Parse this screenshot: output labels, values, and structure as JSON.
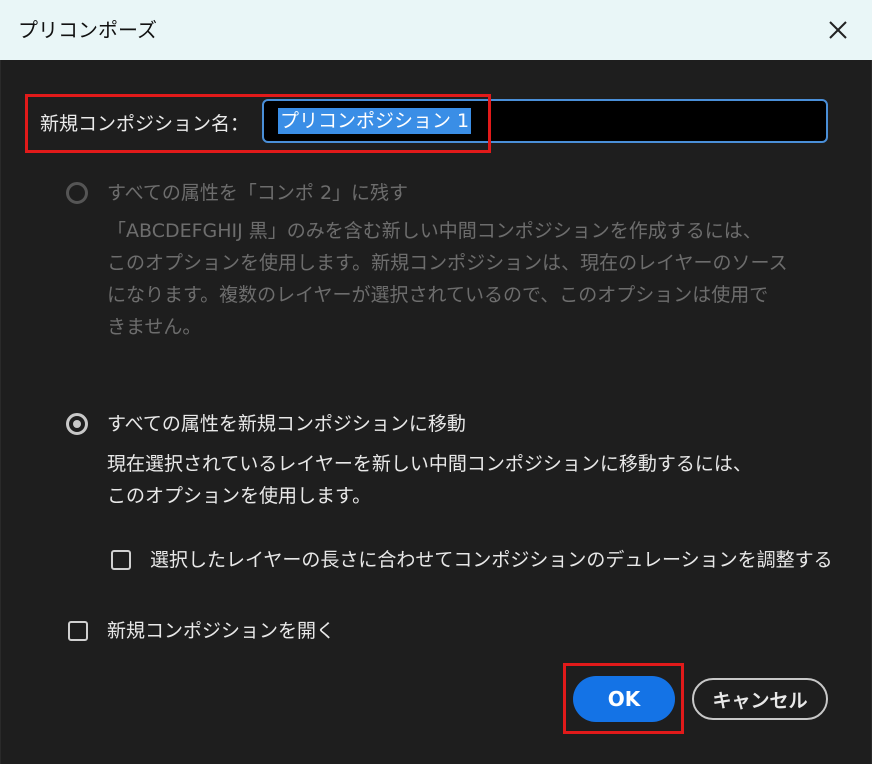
{
  "window": {
    "title": "プリコンポーズ",
    "close_icon": "close-icon"
  },
  "name_field": {
    "label": "新規コンポジション名：",
    "value": "プリコンポジション 1"
  },
  "option_leave": {
    "title": "すべての属性を「コンポ 2」に残す",
    "description": "「ABCDEFGHIJ 黒」のみを含む新しい中間コンポジションを作成するには、\nこのオプションを使用します。新規コンポジションは、現在のレイヤーのソース\nになります。複数のレイヤーが選択されているので、このオプションは使用で\nきません。",
    "enabled": false,
    "checked": false
  },
  "option_move": {
    "title": "すべての属性を新規コンポジションに移動",
    "description": "現在選択されているレイヤーを新しい中間コンポジションに移動するには、\nこのオプションを使用します。",
    "enabled": true,
    "checked": true
  },
  "adjust_duration": {
    "label": "選択したレイヤーの長さに合わせてコンポジションのデュレーションを調整する",
    "checked": false
  },
  "open_new_comp": {
    "label": "新規コンポジションを開く",
    "checked": false
  },
  "buttons": {
    "ok": "OK",
    "cancel": "キャンセル"
  },
  "colors": {
    "titlebar": "#e9f6f7",
    "dialog_bg": "#1e1e1e",
    "accent": "#1473e6",
    "highlight_box": "#e11a1a"
  }
}
